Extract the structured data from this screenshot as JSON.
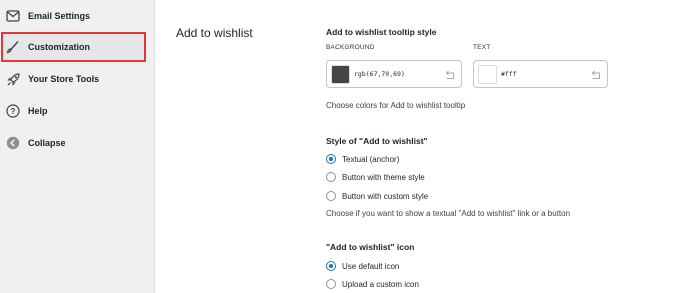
{
  "sidebar": {
    "items": [
      {
        "label": "Email Settings",
        "icon": "envelope-icon"
      },
      {
        "label": "Customization",
        "icon": "brush-icon",
        "active": true
      },
      {
        "label": "Your Store Tools",
        "icon": "rocket-icon"
      },
      {
        "label": "Help",
        "icon": "help-icon"
      },
      {
        "label": "Collapse",
        "icon": "collapse-icon"
      }
    ]
  },
  "section": {
    "title": "Add to wishlist"
  },
  "tooltip_style": {
    "title": "Add to wishlist tooltip style",
    "background_label": "BACKGROUND",
    "background_value": "rgb(67,70,69)",
    "background_color": "#434645",
    "text_label": "TEXT",
    "text_value": "#fff",
    "text_color": "#ffffff",
    "description": "Choose colors for Add to wishlist tooltip"
  },
  "style_group": {
    "title": "Style of \"Add to wishlist\"",
    "options": [
      {
        "label": "Textual (anchor)",
        "checked": true
      },
      {
        "label": "Button with theme style",
        "checked": false
      },
      {
        "label": "Button with custom style",
        "checked": false
      }
    ],
    "description": "Choose if you want to show a textual \"Add to wishlist\" link or a button"
  },
  "icon_group": {
    "title": "\"Add to wishlist\" icon",
    "options": [
      {
        "label": "Use default icon",
        "checked": true
      },
      {
        "label": "Upload a custom icon",
        "checked": false
      }
    ]
  },
  "colors": {
    "accent": "#2271b1",
    "highlight_border": "#e63535"
  }
}
